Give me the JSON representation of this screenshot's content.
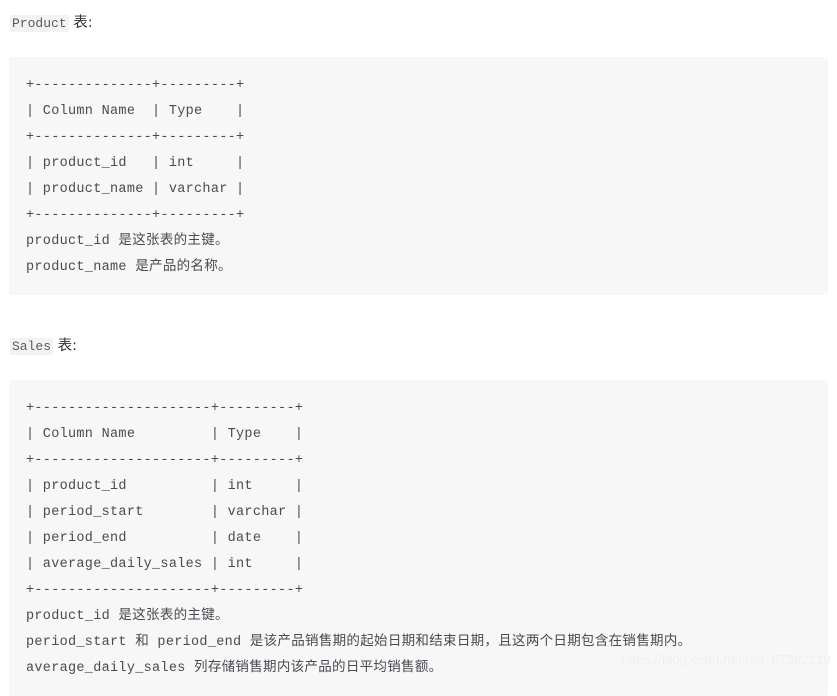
{
  "document": {
    "background_color": "#ffffff",
    "code_block_background": "#f7f7f8",
    "inline_code_background": "#f2f2f3",
    "text_color": "#4a4a50"
  },
  "sections": [
    {
      "heading": {
        "code_label": "Product",
        "suffix": " 表:"
      },
      "code": "+--------------+---------+\n| Column Name  | Type    |\n+--------------+---------+\n| product_id   | int     |\n| product_name | varchar |\n+--------------+---------+",
      "notes": [
        "product_id 是这张表的主键。",
        "product_name 是产品的名称。"
      ]
    },
    {
      "heading": {
        "code_label": "Sales",
        "suffix": " 表:"
      },
      "code": "+---------------------+---------+\n| Column Name         | Type    |\n+---------------------+---------+\n| product_id          | int     |\n| period_start        | varchar |\n| period_end          | date    |\n| average_daily_sales | int     |\n+---------------------+---------+",
      "notes": [
        "product_id 是这张表的主键。",
        "period_start 和 period_end 是该产品销售期的起始日期和结束日期，且这两个日期包含在销售期内。",
        "average_daily_sales 列存储销售期内该产品的日平均销售额。"
      ]
    }
  ],
  "watermark": {
    "text": "https://blog.csdn.net/m0_07302219"
  }
}
